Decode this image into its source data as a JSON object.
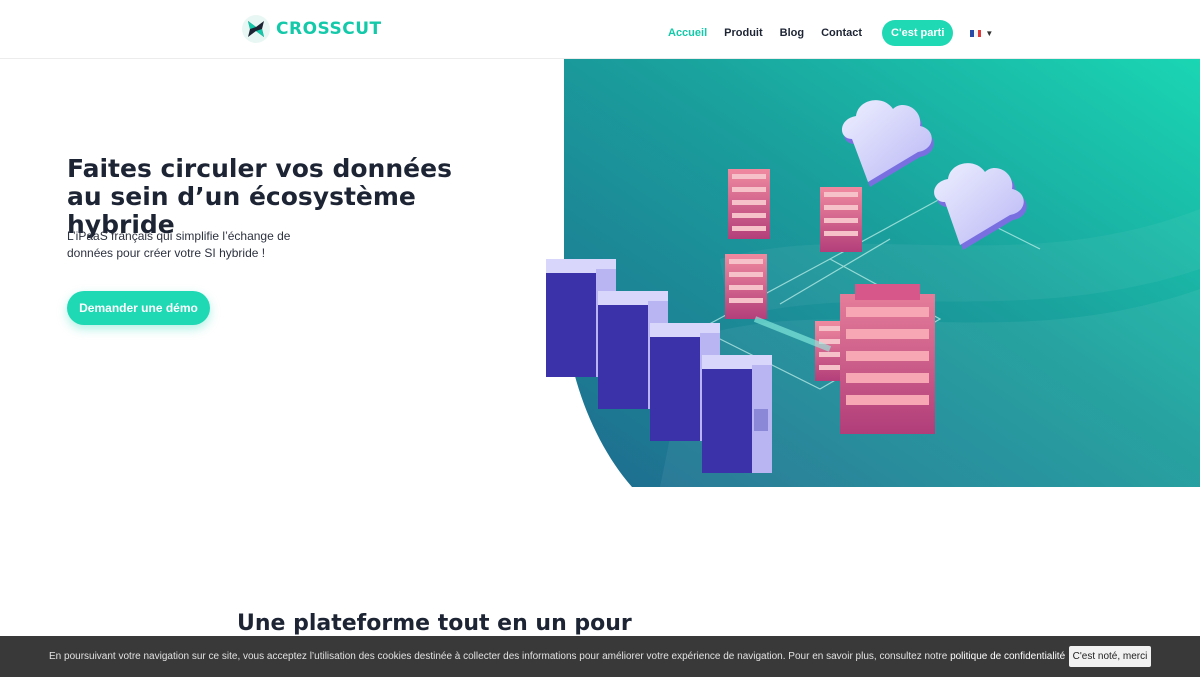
{
  "brand": {
    "name": "CROSSCUT",
    "color": "#14c9a9"
  },
  "nav": {
    "items": [
      {
        "label": "Accueil",
        "active": true
      },
      {
        "label": "Produit"
      },
      {
        "label": "Blog"
      },
      {
        "label": "Contact"
      }
    ],
    "cta": "C'est parti",
    "language": {
      "flag": "flag-fr-icon",
      "selected": "FR"
    }
  },
  "hero": {
    "title": "Faites circuler vos données au sein d’un écosystème hybride",
    "subtitle": "L’iPaaS français qui simplifie l’échange de données pour créer votre SI hybride !",
    "button": "Demander une démo"
  },
  "section": {
    "title": "Une plateforme tout en un pour"
  },
  "cookie": {
    "text": "En poursuivant votre navigation sur ce site, vous acceptez l’utilisation des cookies destinée à collecter des informations pour améliorer votre expérience de navigation. Pour en savoir plus, consultez notre",
    "link": "politique de confidentialité",
    "button": "C'est noté, merci"
  },
  "colors": {
    "accent": "#1fd8b4",
    "text": "#1d2434",
    "hero_bg_start": "#1ad6b3",
    "hero_bg_end": "#1f6f8f"
  }
}
